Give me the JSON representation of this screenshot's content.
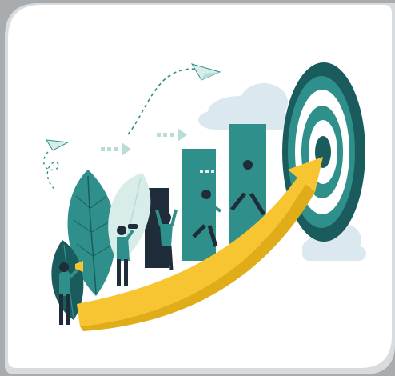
{
  "colors": {
    "backdrop": "#a9acae",
    "card": "#ffffff",
    "teal": "#2f8f8a",
    "dark_teal": "#1a5c5e",
    "navy": "#1f2d3a",
    "light_teal": "#b9dcd6",
    "mint": "#d8ece9",
    "yellow": "#f7c531",
    "cloud": "#dbe8ef"
  },
  "illustration": {
    "figures": [
      "person-with-megaphone",
      "person-with-binoculars",
      "person-cheering",
      "person-running",
      "person-jumping"
    ],
    "icons": [
      "paper-plane-icon",
      "arrow-chevrons-icon",
      "target-icon",
      "growth-arrow-icon"
    ]
  }
}
